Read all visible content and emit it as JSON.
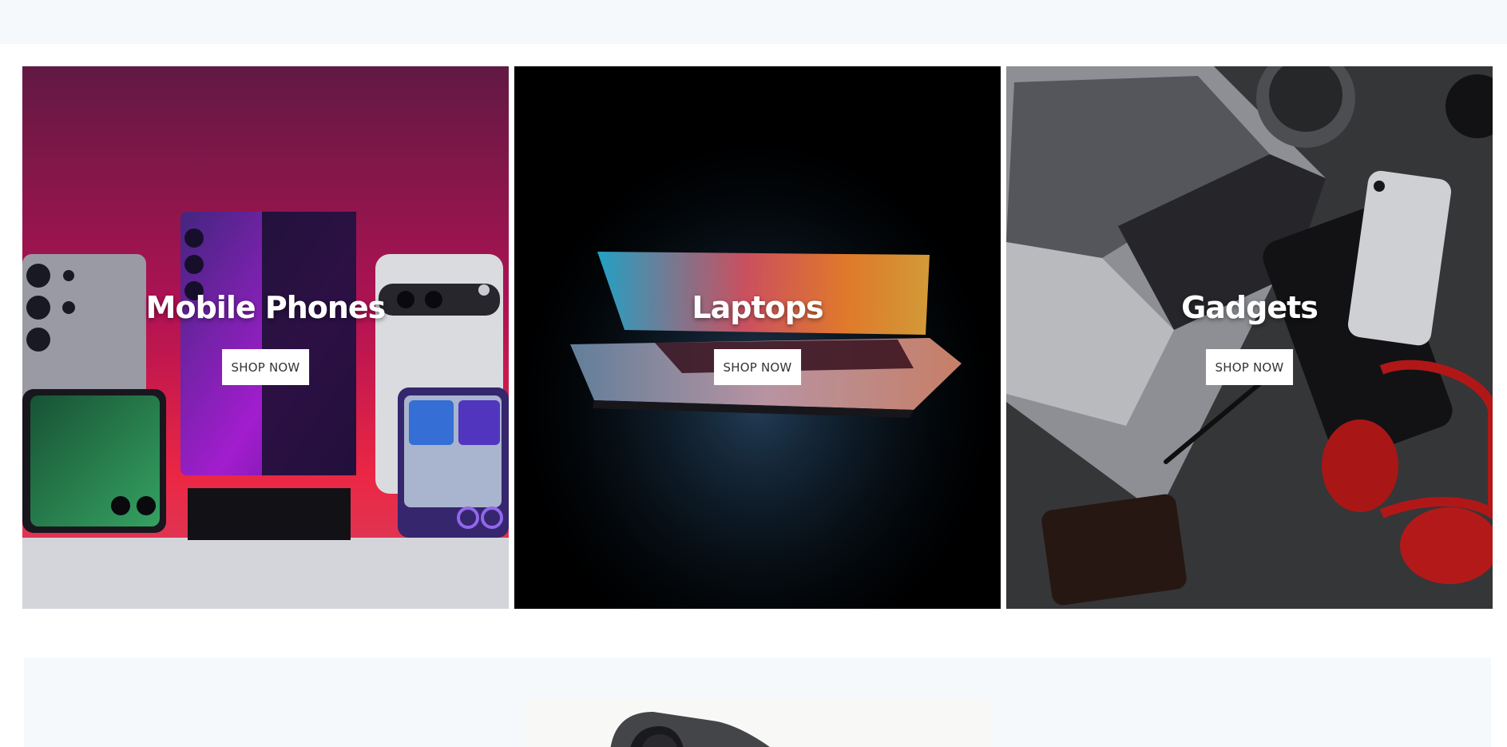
{
  "categories": [
    {
      "title": "Mobile Phones",
      "button": "SHOP NOW"
    },
    {
      "title": "Laptops",
      "button": "SHOP NOW"
    },
    {
      "title": "Gadgets",
      "button": "SHOP NOW"
    }
  ],
  "colors": {
    "page_background": "#ffffff",
    "strip_background": "#f5f9fc",
    "button_background": "#ffffff",
    "button_text": "#333333",
    "title_text": "#ffffff"
  }
}
